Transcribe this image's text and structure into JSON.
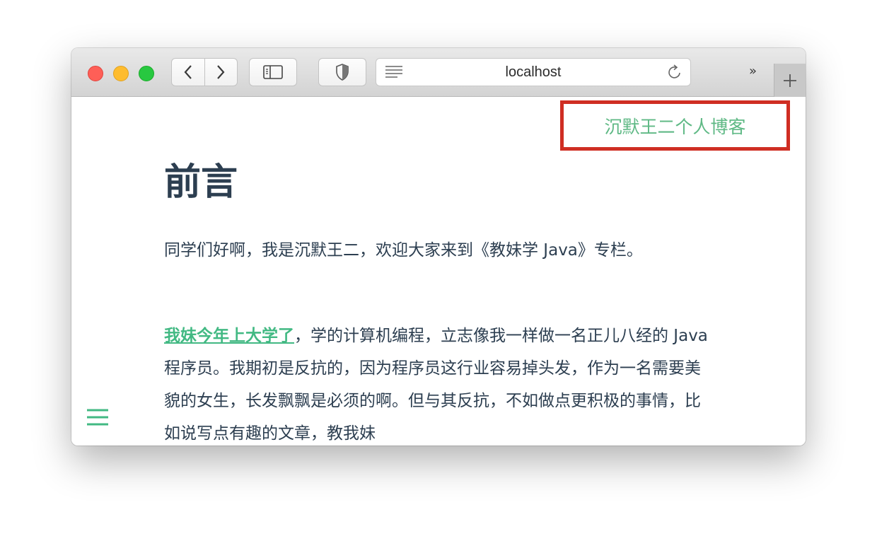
{
  "browser": {
    "address": "localhost",
    "icons": {
      "back": "chevron-left-icon",
      "forward": "chevron-right-icon",
      "sidebar": "sidebar-icon",
      "privacy": "shield-icon",
      "reader": "reader-icon",
      "reload": "reload-icon",
      "more": "double-chevron-icon",
      "new_tab": "plus-icon"
    },
    "more_label": "»",
    "new_tab_label": "+"
  },
  "page": {
    "top_link": "沉默王二个人博客",
    "title": "前言",
    "para1": "同学们好啊，我是沉默王二，欢迎大家来到《教妹学 Java》专栏。",
    "para2_link": "我妹今年上大学了",
    "para2_rest": "，学的计算机编程，立志像我一样做一名正儿八经的 Java 程序员。我期初是反抗的，因为程序员这行业容易掉头发，作为一名需要美貌的女生，长发飘飘是必须的啊。但与其反抗，不如做点更积极的事情，比如说写点有趣的文章，教我妹",
    "menu_icon": "hamburger-menu-icon"
  },
  "colors": {
    "accent": "#42b983",
    "text": "#2c3e50",
    "highlight_border": "#cf2e23"
  }
}
